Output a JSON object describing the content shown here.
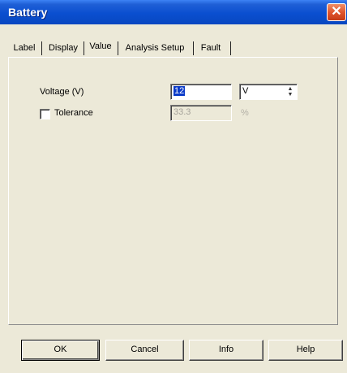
{
  "window": {
    "title": "Battery",
    "close_glyph": "✕"
  },
  "tabs": [
    {
      "label": "Label",
      "active": false
    },
    {
      "label": "Display",
      "active": false
    },
    {
      "label": "Value",
      "active": true
    },
    {
      "label": "Analysis Setup",
      "active": false
    },
    {
      "label": "Fault",
      "active": false
    }
  ],
  "value": {
    "voltage_label": "Voltage (V)",
    "voltage_value": "12",
    "voltage_unit": "V",
    "tolerance_label": "Tolerance",
    "tolerance_checked": false,
    "tolerance_value": "33.3",
    "tolerance_unit": "%"
  },
  "buttons": {
    "ok": "OK",
    "cancel": "Cancel",
    "info": "Info",
    "help": "Help"
  }
}
